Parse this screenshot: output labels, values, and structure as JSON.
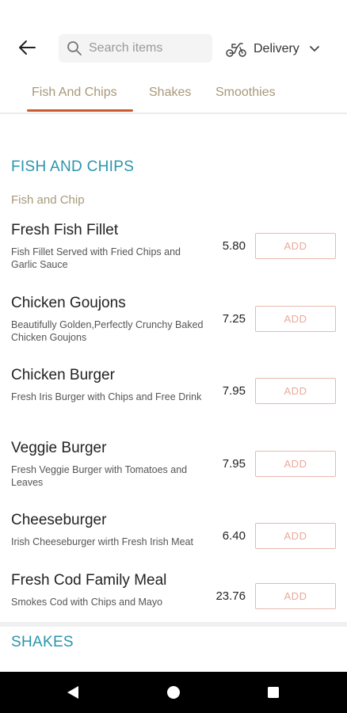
{
  "header": {
    "search_placeholder": "Search items",
    "delivery_label": "Delivery"
  },
  "tabs": [
    {
      "label": "Fish And Chips",
      "active": true
    },
    {
      "label": "Shakes",
      "active": false
    },
    {
      "label": "Smoothies",
      "active": false
    }
  ],
  "sections": {
    "fish_and_chips": {
      "title": "FISH AND CHIPS",
      "subtitle": "Fish and Chip",
      "items": [
        {
          "name": "Fresh Fish Fillet",
          "description": "Fish Fillet Served with Fried Chips and Garlic Sauce",
          "price": "5.80",
          "add_label": "ADD"
        },
        {
          "name": "Chicken Goujons",
          "description": "Beautifully Golden,Perfectly Crunchy Baked Chicken Goujons",
          "price": "7.25",
          "add_label": "ADD"
        },
        {
          "name": "Chicken Burger",
          "description": "Fresh Iris Burger with Chips and Free Drink",
          "price": "7.95",
          "add_label": "ADD"
        },
        {
          "name": "Veggie Burger",
          "description": "Fresh Veggie Burger with Tomatoes and Leaves",
          "price": "7.95",
          "add_label": "ADD"
        },
        {
          "name": "Cheeseburger",
          "description": "Irish Cheeseburger wirth Fresh Irish Meat",
          "price": "6.40",
          "add_label": "ADD"
        },
        {
          "name": "Fresh Cod Family Meal",
          "description": "Smokes Cod with Chips and Mayo",
          "price": "23.76",
          "add_label": "ADD"
        }
      ]
    },
    "shakes": {
      "title": "SHAKES"
    }
  },
  "colors": {
    "accent_teal": "#2a95ad",
    "tab_text": "#a89878",
    "tab_underline": "#c95b2c",
    "add_border": "#e8b8ae"
  },
  "icons": {
    "back": "arrow-left-icon",
    "search": "search-icon",
    "delivery": "scooter-icon",
    "dropdown": "chevron-down-icon",
    "nav_back": "triangle-back-icon",
    "nav_home": "circle-home-icon",
    "nav_recents": "square-recents-icon"
  }
}
